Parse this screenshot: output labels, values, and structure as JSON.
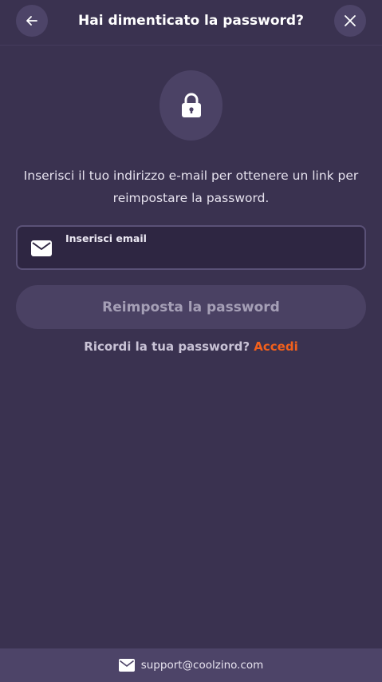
{
  "header": {
    "title": "Hai dimenticato la password?",
    "back_icon": "arrow-left-icon",
    "close_icon": "close-icon"
  },
  "lock": {
    "icon": "lock-icon"
  },
  "description": "Inserisci il tuo indirizzo e-mail per ottenere un link per reimpostare la password.",
  "email_field": {
    "icon": "envelope-icon",
    "label": "Inserisci email",
    "value": ""
  },
  "reset_button": {
    "label": "Reimposta la password"
  },
  "remember": {
    "prompt": "Ricordi la tua password?",
    "link_label": "Accedi"
  },
  "footer": {
    "icon": "envelope-icon",
    "email": "support@coolzino.com"
  },
  "colors": {
    "background": "#3a3250",
    "accent": "#f2601c",
    "button_bg": "#4a4163",
    "button_text": "#a59fb6"
  }
}
